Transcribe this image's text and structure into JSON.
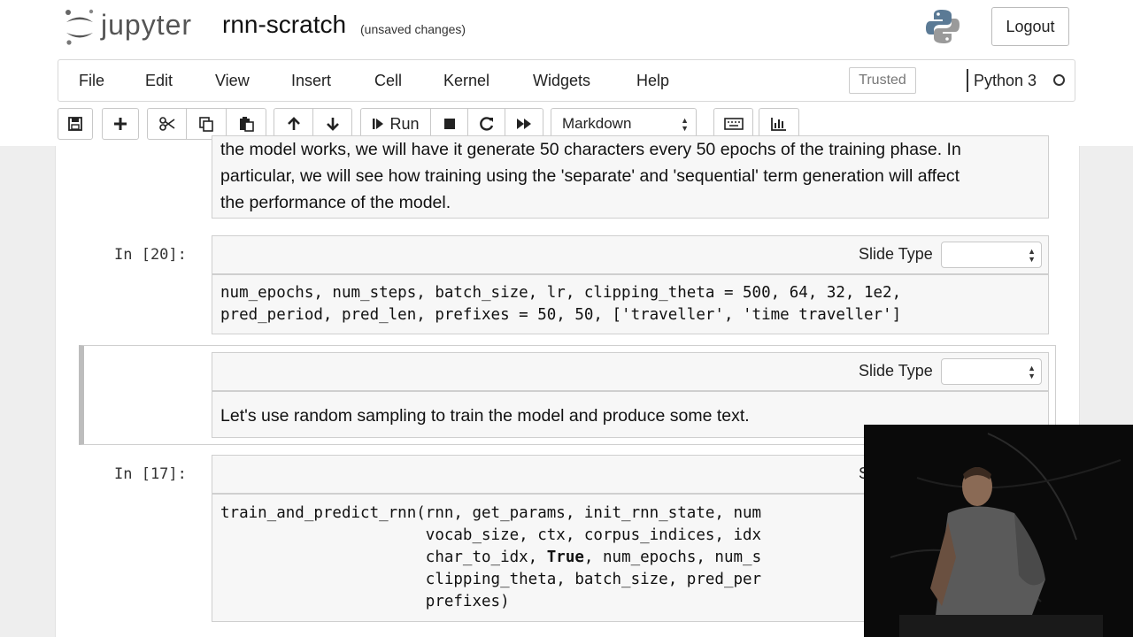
{
  "app": {
    "logo_text": "jupyter",
    "notebook_name": "rnn-scratch",
    "save_status": "(unsaved changes)",
    "logout_label": "Logout"
  },
  "menu": {
    "items": [
      "File",
      "Edit",
      "View",
      "Insert",
      "Cell",
      "Kernel",
      "Widgets",
      "Help"
    ],
    "trusted_label": "Trusted",
    "kernel_name": "Python 3"
  },
  "toolbar": {
    "buttons": [
      "save-icon",
      "plus-icon",
      "scissors-icon",
      "copy-icon",
      "paste-icon",
      "arrow-up-icon",
      "arrow-down-icon",
      "run",
      "stop-icon",
      "restart-icon",
      "fast-forward-icon",
      "keyboard-icon",
      "bar-chart-icon"
    ],
    "run_label": "Run",
    "cell_type": "Markdown"
  },
  "cells": {
    "md1": {
      "lines": [
        "the model works, we will have it generate 50 characters every 50 epochs of the training phase. In",
        "particular, we will see how training using the 'separate' and 'sequential' term generation will affect",
        "the performance of the model."
      ]
    },
    "code1": {
      "prompt": "In [20]:",
      "slide_label": "Slide Type",
      "lines": [
        "num_epochs, num_steps, batch_size, lr, clipping_theta = 500, 64, 32, 1e2,",
        "pred_period, pred_len, prefixes = 50, 50, ['traveller', 'time traveller']"
      ]
    },
    "md2": {
      "slide_label": "Slide Type",
      "text": "Let's use random sampling to train the model and produce some text."
    },
    "code2": {
      "prompt": "In [17]:",
      "slide_label_partial": "S",
      "line0": "train_and_predict_rnn(rnn, get_params, init_rnn_state, num",
      "line1": "                      vocab_size, ctx, corpus_indices, idx",
      "line2_pre": "                      char_to_idx, ",
      "line2_kw": "True",
      "line2_post": ", num_epochs, num_s",
      "line3": "                      clipping_theta, batch_size, pred_per",
      "line4": "                      prefixes)"
    }
  },
  "colors": {
    "page_bg": "#eeeeee",
    "cell_bg": "#f7f7f7",
    "jupyter_orange": "#f37726",
    "python_blue": "#3b6d96",
    "python_yellow": "#e8c63a"
  }
}
